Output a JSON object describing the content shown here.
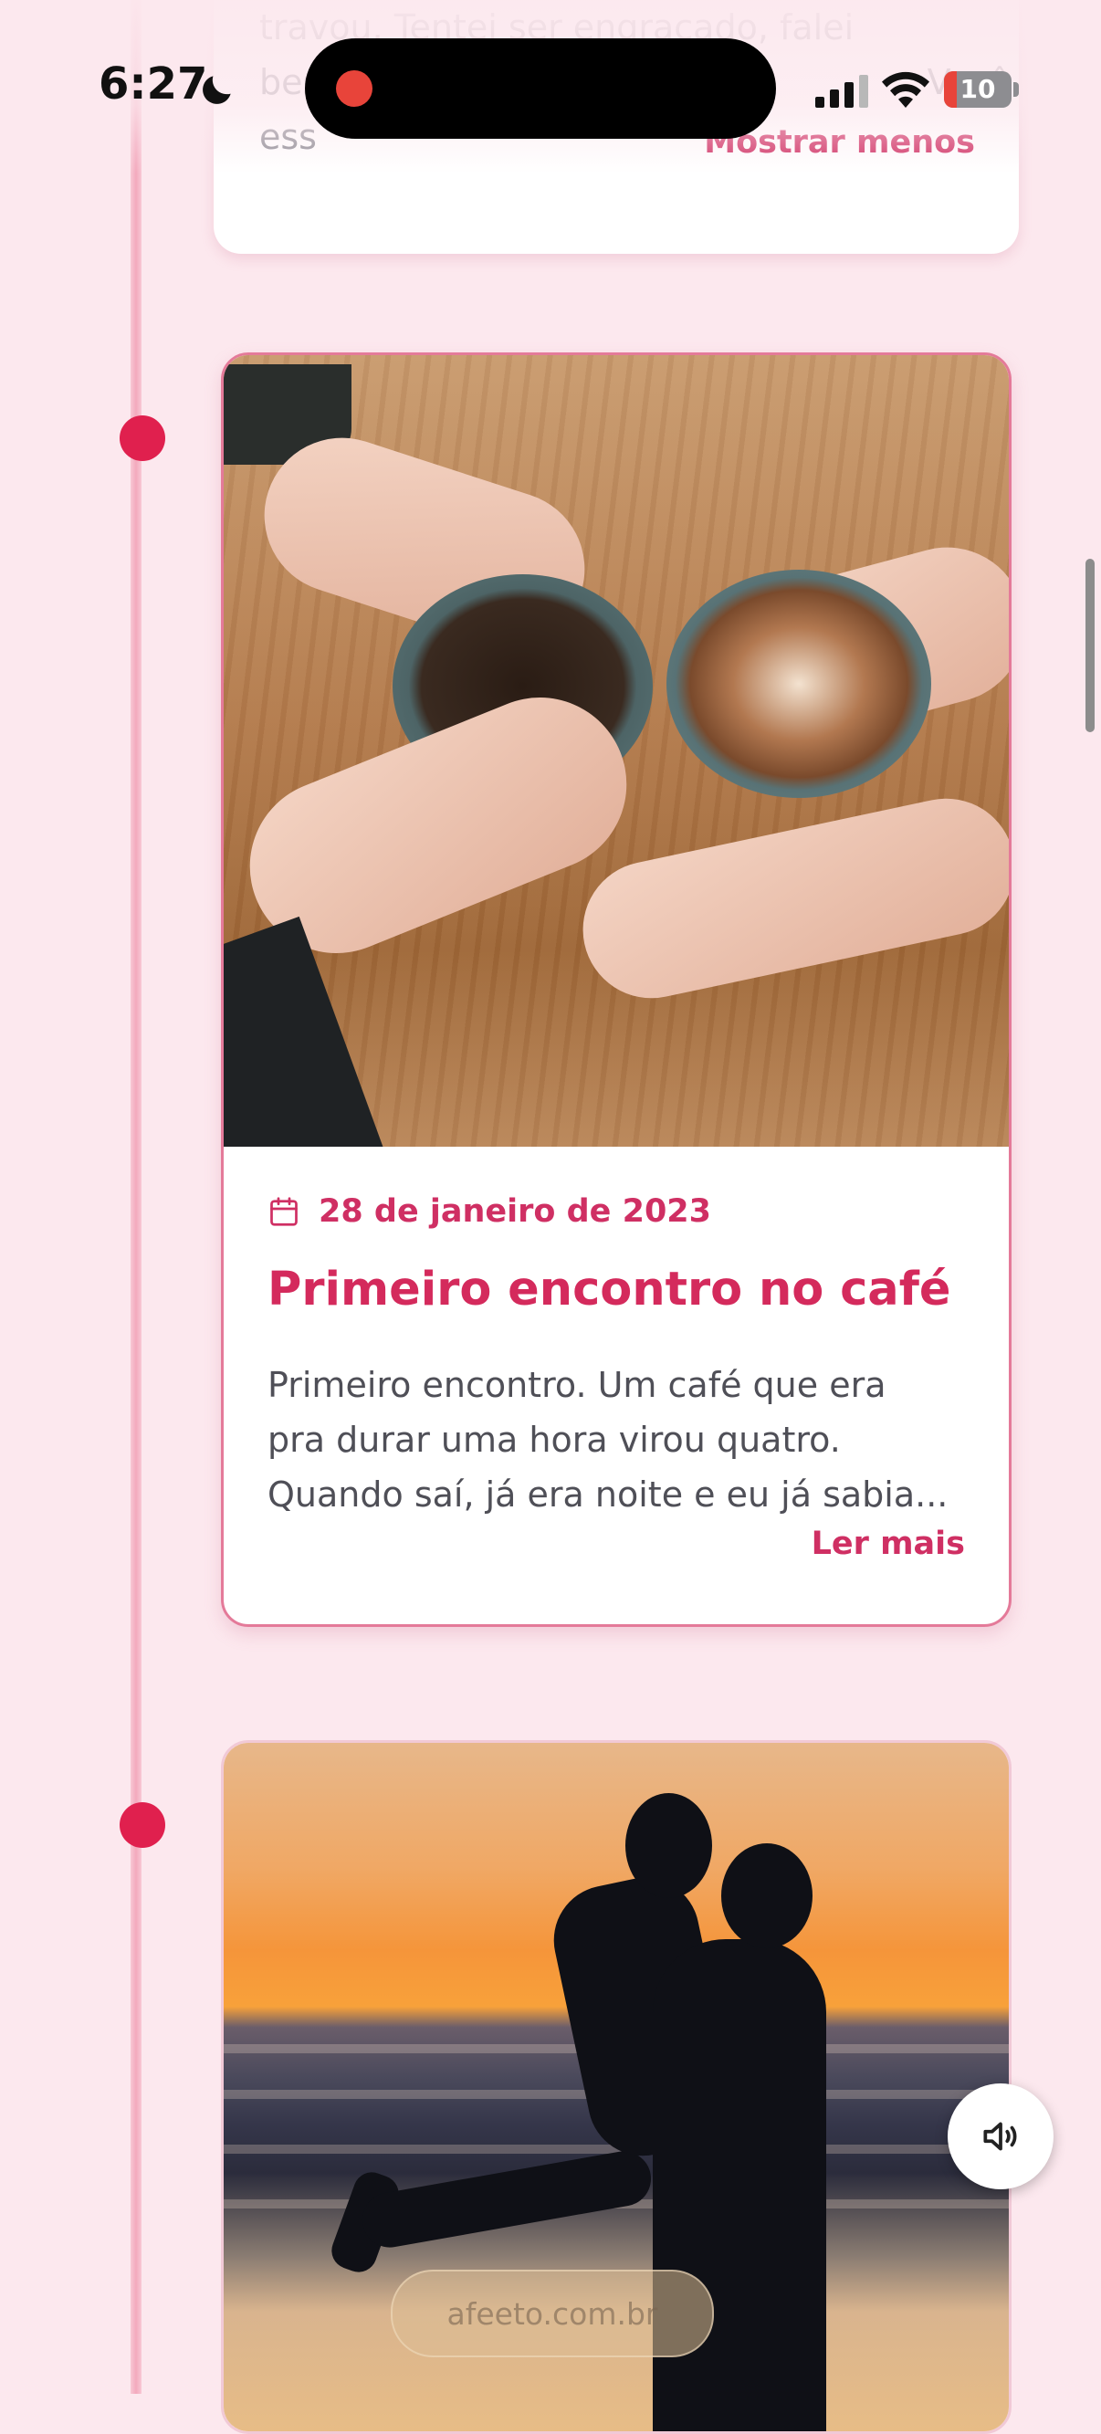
{
  "status_bar": {
    "time": "6:27",
    "battery": "10",
    "moon_icon": "moon-icon",
    "signal_icon": "cellular-signal-icon",
    "wifi_icon": "wifi-icon",
    "recording_icon": "recording-dot-icon"
  },
  "top_card": {
    "partial_lines": [
      "travou. Tentei ser engraçado, falei",
      "bes                                                       Você riu — e",
      "ess"
    ],
    "show_less_label": "Mostrar menos"
  },
  "timeline_cards": [
    {
      "date": "28 de janeiro de 2023",
      "title": "Primeiro encontro no café",
      "description_lines": [
        "Primeiro encontro. Um café que era",
        "pra durar uma hora virou quatro.",
        "Quando saí, já era noite e eu já sabia..."
      ],
      "read_more_label": "Ler mais",
      "image_description": "two hands holding coffee cups"
    },
    {
      "image_description": "couple kissing at sunset on the beach"
    }
  ],
  "sound_button": {
    "icon": "speaker-icon"
  },
  "browser": {
    "url": "afeeto.com.br"
  },
  "colors": {
    "accent": "#d42a5c",
    "timeline_dot": "#e0204e",
    "background": "#fce8ee"
  }
}
